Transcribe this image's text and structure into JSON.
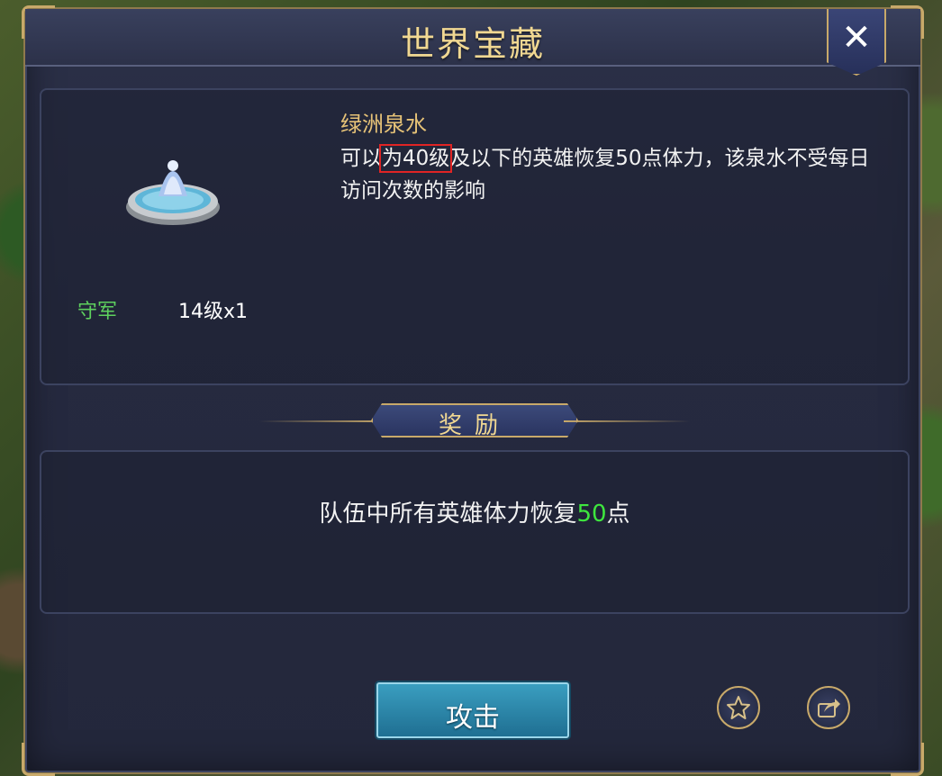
{
  "dialog": {
    "title": "世界宝藏",
    "close_label": "✕"
  },
  "treasure": {
    "name": "绿洲泉水",
    "desc_part1": "可以",
    "desc_highlight": "为40级",
    "desc_part2": "及以下的英雄恢复50点体力，该泉水不受每日访问次数的影响",
    "guard_label": "守军",
    "guard_value": "14级x1",
    "icon": "fountain-icon"
  },
  "reward": {
    "header": "奖励",
    "desc_prefix": "队伍中所有英雄体力恢复",
    "desc_number": "50",
    "desc_suffix": "点"
  },
  "actions": {
    "attack_label": "攻击",
    "favorite_icon": "star-icon",
    "share_icon": "share-icon"
  },
  "colors": {
    "title": "#f1d892",
    "guard_label": "#5ed15e",
    "reward_number": "#3ee63e",
    "highlight_box": "#e02424",
    "attack_button": "#2a88ad"
  }
}
